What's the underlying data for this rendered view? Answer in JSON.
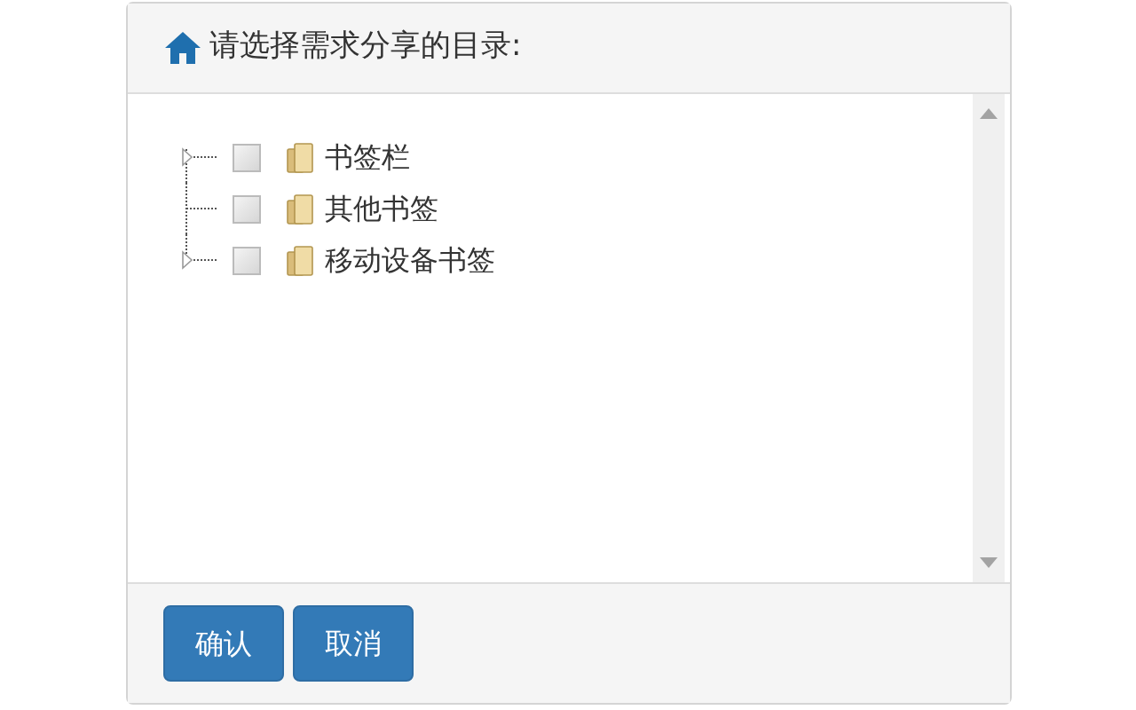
{
  "dialog": {
    "title": "请选择需求分享的目录:"
  },
  "tree": [
    {
      "label": "书签栏",
      "checked": false,
      "has_children": true
    },
    {
      "label": "其他书签",
      "checked": false,
      "has_children": false
    },
    {
      "label": "移动设备书签",
      "checked": false,
      "has_children": true
    }
  ],
  "buttons": [
    "确认",
    "取消"
  ]
}
